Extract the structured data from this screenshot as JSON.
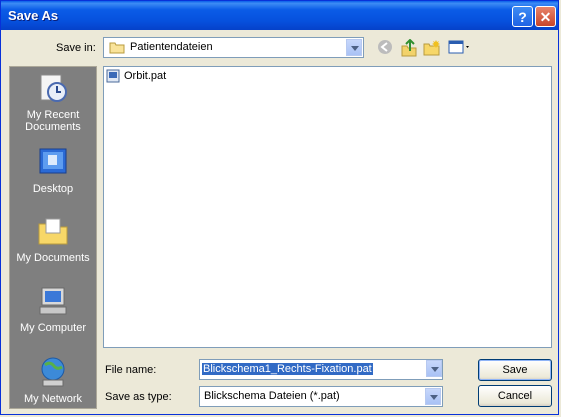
{
  "window": {
    "title": "Save As"
  },
  "toolbar": {
    "save_in_label": "Save in:",
    "save_in_value": "Patientendateien"
  },
  "places": [
    {
      "label": "My Recent Documents",
      "icon": "recent-documents-icon"
    },
    {
      "label": "Desktop",
      "icon": "desktop-icon"
    },
    {
      "label": "My Documents",
      "icon": "my-documents-icon"
    },
    {
      "label": "My Computer",
      "icon": "my-computer-icon"
    },
    {
      "label": "My Network",
      "icon": "my-network-icon"
    }
  ],
  "files": [
    {
      "name": "Orbit.pat",
      "icon": "pat-file-icon"
    }
  ],
  "form": {
    "file_name_label": "File name:",
    "file_name_value": "Blickschema1_Rechts-Fixation.pat",
    "save_type_label": "Save as type:",
    "save_type_value": "Blickschema Dateien (*.pat)"
  },
  "buttons": {
    "save": "Save",
    "cancel": "Cancel"
  },
  "colors": {
    "titlebar": "#0654e0",
    "dialog_bg": "#ece9d8",
    "places_bg": "#7f7f7f",
    "selection": "#316ac5"
  }
}
